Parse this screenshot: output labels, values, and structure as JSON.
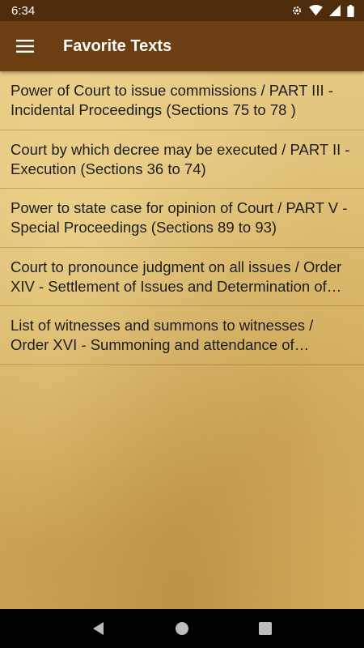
{
  "status_bar": {
    "time": "6:34",
    "icons": [
      "gear-icon",
      "wifi-icon",
      "cellular-icon",
      "battery-icon"
    ]
  },
  "app_bar": {
    "title": "Favorite Texts",
    "menu_icon": "menu-icon"
  },
  "favorites": [
    {
      "text": "Power of Court to issue commissions / PART III - Incidental Proceedings (Sections 75 to 78 )"
    },
    {
      "text": "Court by which decree may be executed / PART II - Execution (Sections 36 to 74)"
    },
    {
      "text": "Power to state case for opinion of Court / PART V - Special Proceedings (Sections 89 to 93)"
    },
    {
      "text": "Court to pronounce judgment on all issues / Order XIV - Settlement of Issues and Determination of issues on issues of law or on issues agreed upon"
    },
    {
      "text": "List of witnesses and summons to witnesses / Order XVI - Summoning and attendance of Witnesses"
    }
  ],
  "nav_bar": {
    "icons": [
      "back-icon",
      "home-icon",
      "recents-icon"
    ]
  },
  "colors": {
    "status_bar": "#4e2c0c",
    "app_bar": "#6b3f12",
    "parchment": "#dcbb6e"
  }
}
